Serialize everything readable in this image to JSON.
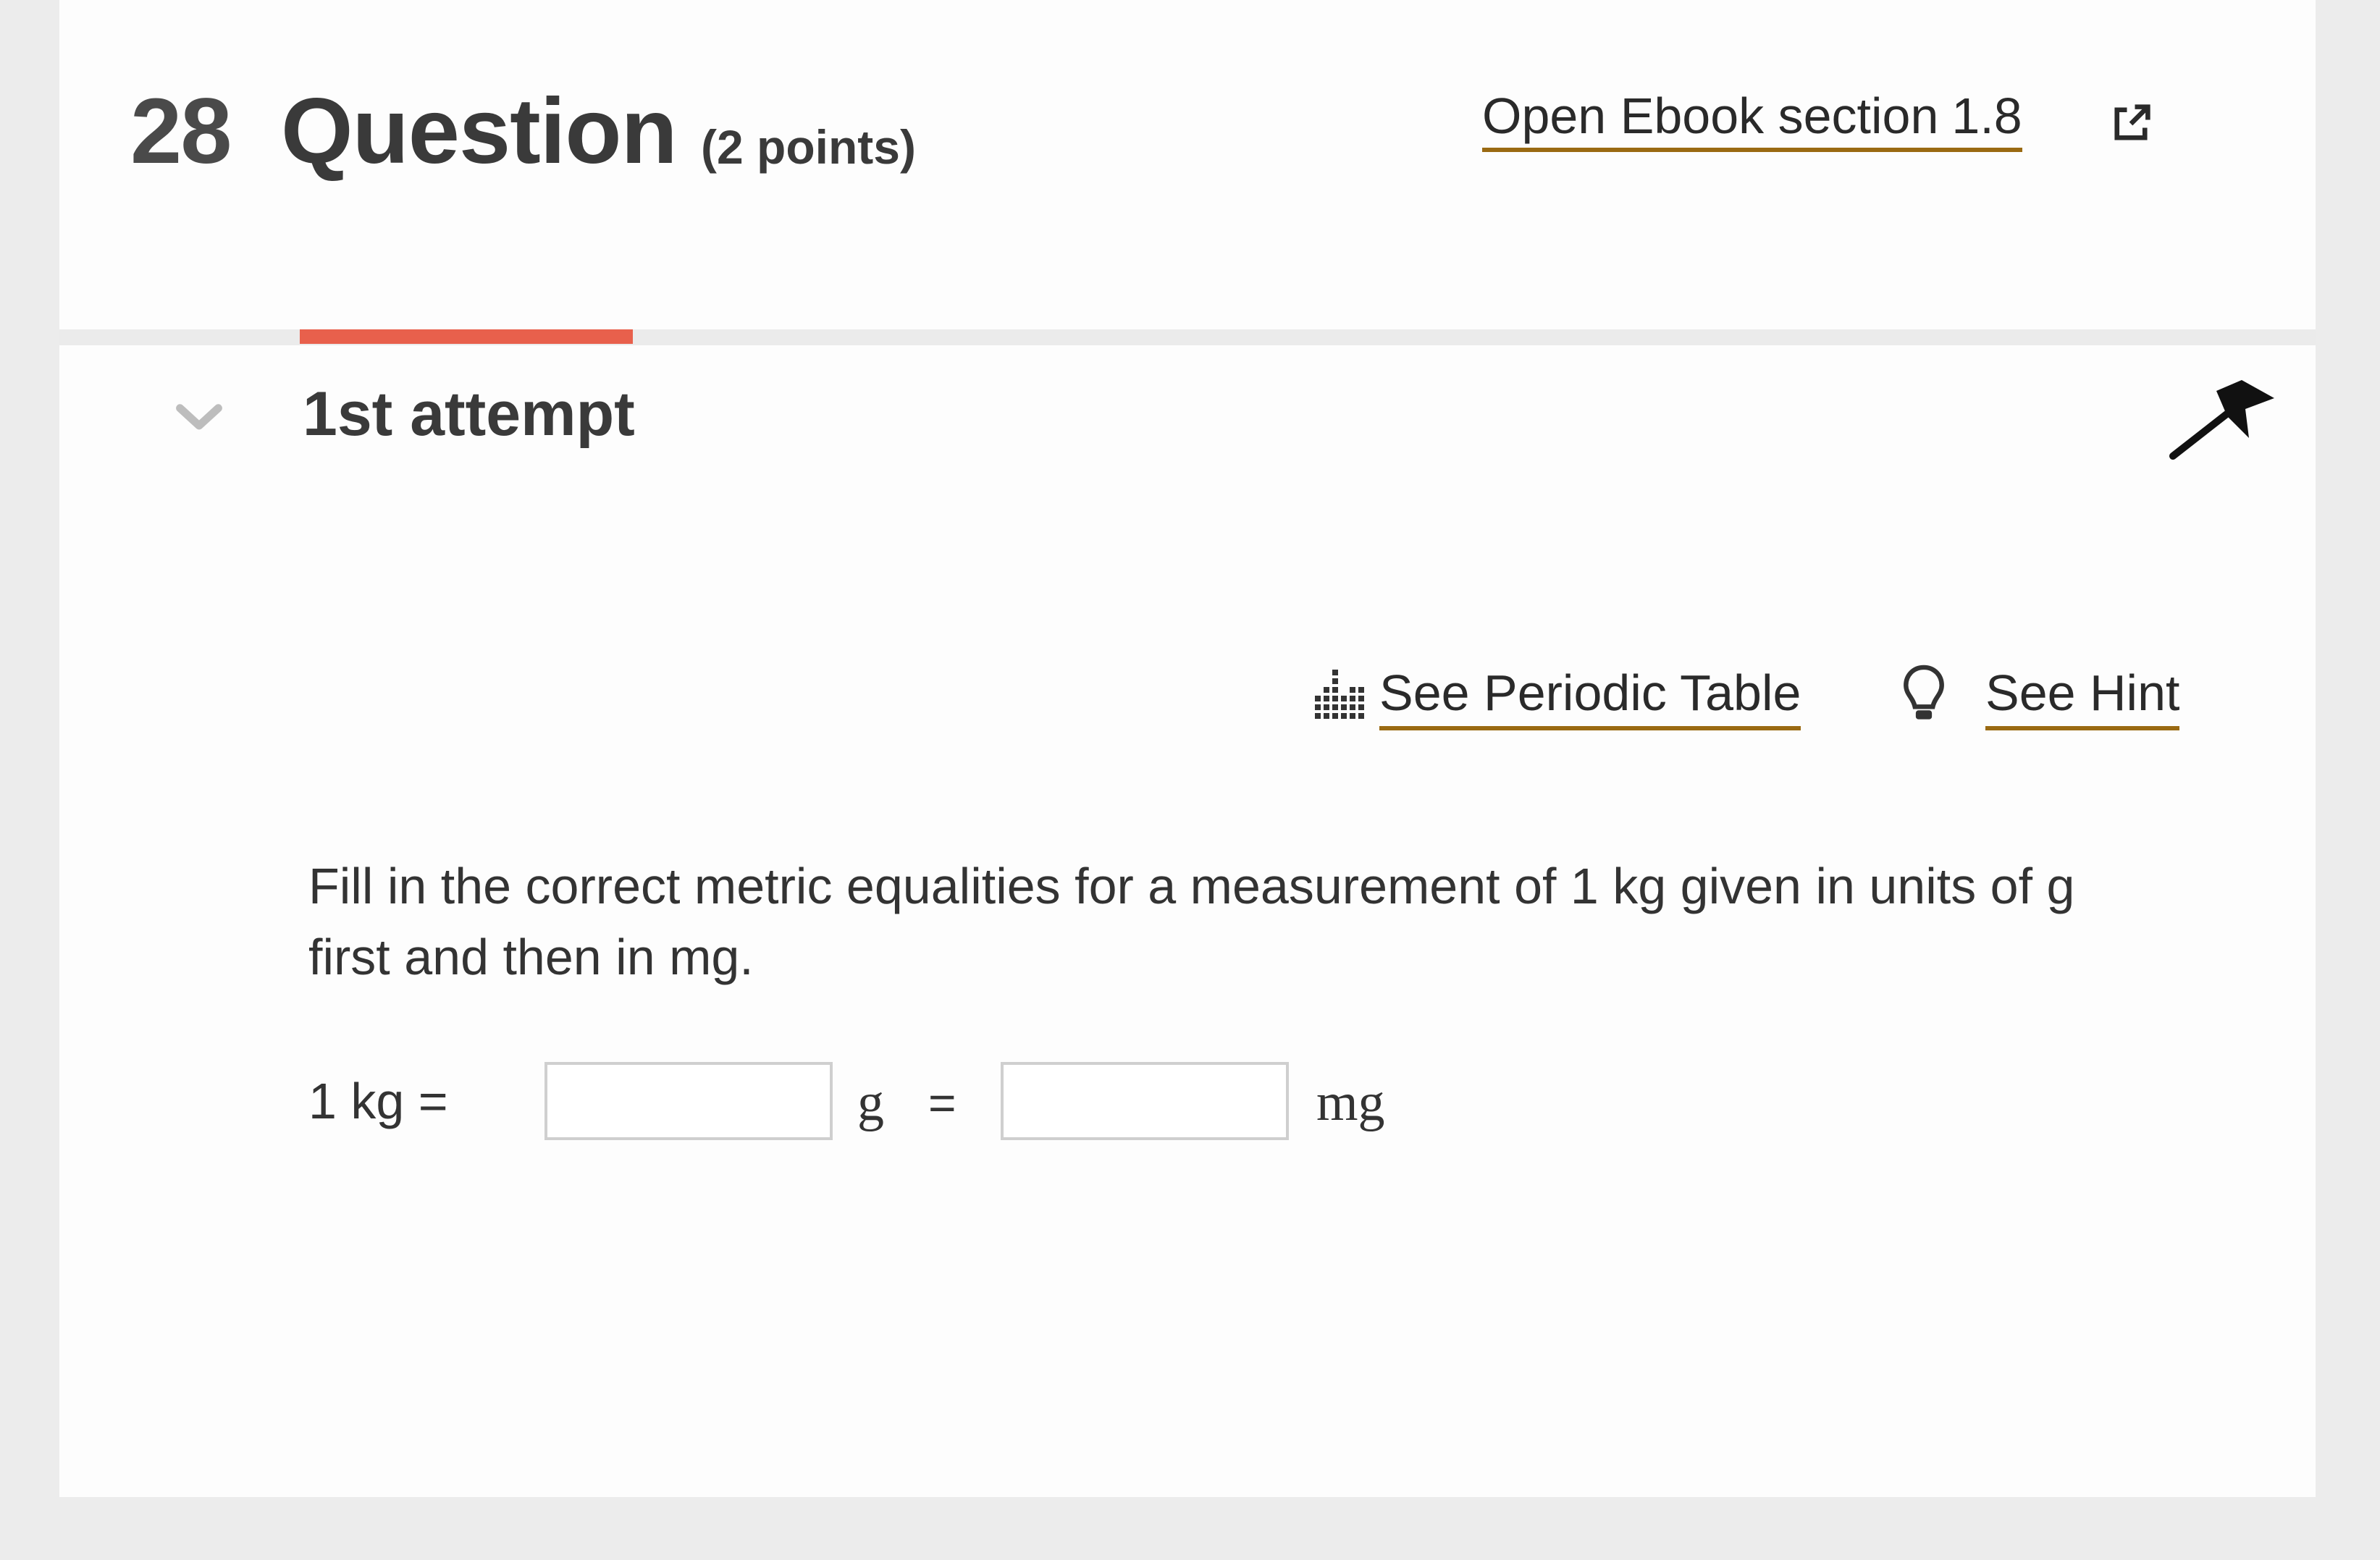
{
  "question": {
    "number": "28",
    "title": "Question",
    "points": "(2 points)"
  },
  "ebook": {
    "label": "Open Ebook section",
    "section": "1.8",
    "icon": "external-link-icon"
  },
  "attempt": {
    "label": "1st attempt"
  },
  "tools": {
    "periodic_table": "See Periodic Table",
    "hint": "See Hint"
  },
  "prompt": {
    "text": "Fill in the correct metric equalities for a measurement of 1 kg given in units of g first and then in mg."
  },
  "equation": {
    "lhs": "1 kg =",
    "unit_1": "g",
    "equals": "=",
    "unit_2": "mg",
    "input_g_value": "",
    "input_mg_value": ""
  },
  "colors": {
    "accent_underline": "#9a6a12",
    "progress": "#e8604c",
    "background": "#ececec",
    "card": "#fdfdfd"
  }
}
